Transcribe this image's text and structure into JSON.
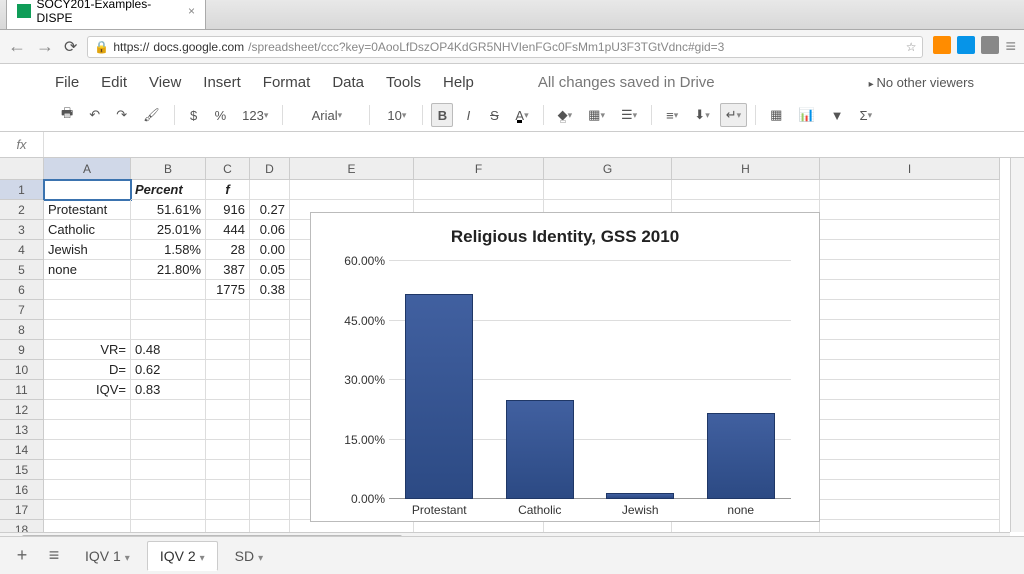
{
  "browser": {
    "tab_title": "SOCY201-Examples-DISPE",
    "url_https": "https://",
    "url_domain": "docs.google.com",
    "url_path": "/spreadsheet/ccc?key=0AooLfDszOP4KdGR5NHVIenFGc0FsMm1pU3F3TGtVdnc#gid=3"
  },
  "menus": {
    "file": "File",
    "edit": "Edit",
    "view": "View",
    "insert": "Insert",
    "format": "Format",
    "data": "Data",
    "tools": "Tools",
    "help": "Help"
  },
  "status": {
    "save": "All changes saved in Drive",
    "viewers": "No other viewers"
  },
  "toolbar": {
    "dollar": "$",
    "percent": "%",
    "123": "123",
    "font": "Arial",
    "size": "10",
    "bold": "B",
    "italic": "I",
    "strike": "S",
    "textcolor": "A",
    "sigma": "Σ"
  },
  "fx": "fx",
  "columns": [
    "A",
    "B",
    "C",
    "D",
    "E",
    "F",
    "G",
    "H",
    "I"
  ],
  "header_row": {
    "b": "Percent",
    "c": "f"
  },
  "rows": [
    {
      "n": "1"
    },
    {
      "n": "2",
      "a": "Protestant",
      "b": "51.61%",
      "c": "916",
      "d": "0.27"
    },
    {
      "n": "3",
      "a": "Catholic",
      "b": "25.01%",
      "c": "444",
      "d": "0.06"
    },
    {
      "n": "4",
      "a": "Jewish",
      "b": "1.58%",
      "c": "28",
      "d": "0.00"
    },
    {
      "n": "5",
      "a": "none",
      "b": "21.80%",
      "c": "387",
      "d": "0.05"
    },
    {
      "n": "6",
      "c": "1775",
      "d": "0.38"
    },
    {
      "n": "7"
    },
    {
      "n": "8"
    },
    {
      "n": "9",
      "a": "VR=",
      "b": "0.48"
    },
    {
      "n": "10",
      "a": "D=",
      "b": "0.62"
    },
    {
      "n": "11",
      "a": "IQV=",
      "b": "0.83"
    },
    {
      "n": "12"
    },
    {
      "n": "13"
    },
    {
      "n": "14"
    },
    {
      "n": "15"
    },
    {
      "n": "16"
    },
    {
      "n": "17"
    },
    {
      "n": "18"
    }
  ],
  "chart_data": {
    "type": "bar",
    "title": "Religious Identity, GSS 2010",
    "categories": [
      "Protestant",
      "Catholic",
      "Jewish",
      "none"
    ],
    "values": [
      51.61,
      25.01,
      1.58,
      21.8
    ],
    "ylabel": "",
    "xlabel": "",
    "ylim": [
      0,
      60
    ],
    "yticks": [
      "0.00%",
      "15.00%",
      "30.00%",
      "45.00%",
      "60.00%"
    ]
  },
  "sheets": {
    "s1": "IQV 1",
    "s2": "IQV 2",
    "s3": "SD"
  }
}
